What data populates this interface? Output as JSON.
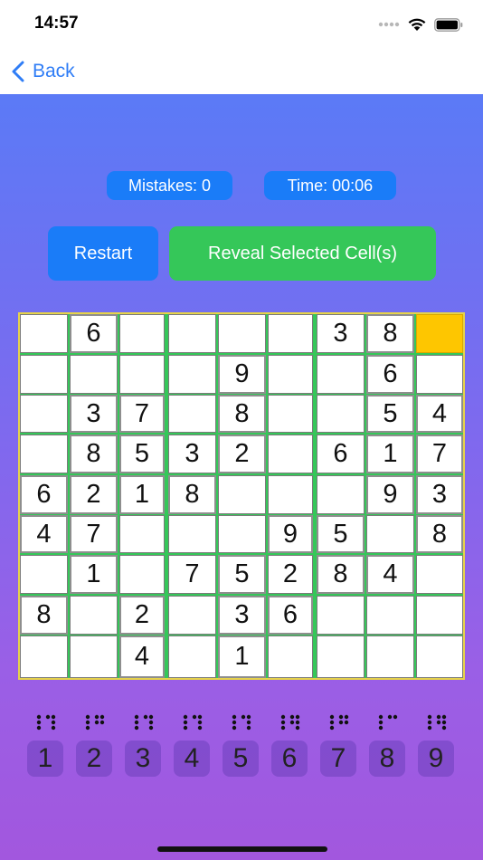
{
  "status_bar": {
    "time": "14:57"
  },
  "nav": {
    "back_label": "Back"
  },
  "stats": {
    "mistakes": "Mistakes: 0",
    "time": "Time: 00:06"
  },
  "actions": {
    "restart": "Restart",
    "reveal": "Reveal Selected Cell(s)"
  },
  "colors": {
    "accent_blue": "#1a7cf8",
    "accent_green": "#35c759",
    "selected_cell": "#fec600",
    "background_top": "#5b7af6",
    "background_bottom": "#a257de"
  },
  "board": {
    "selected": [
      0,
      8
    ],
    "rows": [
      [
        "",
        "6",
        "",
        "",
        "",
        "",
        "3",
        "8",
        ""
      ],
      [
        "",
        "",
        "",
        "",
        "9",
        "",
        "",
        "6",
        ""
      ],
      [
        "",
        "3",
        "7",
        "",
        "8",
        "",
        "",
        "5",
        "4"
      ],
      [
        "",
        "8",
        "5",
        "3",
        "2",
        "",
        "6",
        "1",
        "7"
      ],
      [
        "6",
        "2",
        "1",
        "8",
        "",
        "",
        "",
        "9",
        "3"
      ],
      [
        "4",
        "7",
        "",
        "",
        "",
        "9",
        "5",
        "",
        "8"
      ],
      [
        "",
        "1",
        "",
        "7",
        "5",
        "2",
        "8",
        "4",
        ""
      ],
      [
        "8",
        "",
        "2",
        "",
        "3",
        "6",
        "",
        "",
        ""
      ],
      [
        "",
        "",
        "4",
        "",
        "1",
        "",
        "",
        "",
        ""
      ]
    ],
    "given": [
      [
        0,
        1
      ],
      [
        0,
        7
      ],
      [
        1,
        4
      ],
      [
        1,
        7
      ],
      [
        2,
        1
      ],
      [
        2,
        2
      ],
      [
        2,
        4
      ],
      [
        2,
        7
      ],
      [
        2,
        8
      ],
      [
        3,
        1
      ],
      [
        3,
        2
      ],
      [
        3,
        4
      ],
      [
        3,
        7
      ],
      [
        3,
        8
      ],
      [
        4,
        0
      ],
      [
        4,
        1
      ],
      [
        4,
        2
      ],
      [
        4,
        3
      ],
      [
        4,
        7
      ],
      [
        4,
        8
      ],
      [
        5,
        0
      ],
      [
        5,
        1
      ],
      [
        5,
        5
      ],
      [
        5,
        6
      ],
      [
        5,
        8
      ],
      [
        6,
        1
      ],
      [
        6,
        4
      ],
      [
        6,
        6
      ],
      [
        6,
        7
      ],
      [
        7,
        0
      ],
      [
        7,
        2
      ],
      [
        7,
        4
      ],
      [
        7,
        5
      ],
      [
        8,
        2
      ],
      [
        8,
        4
      ]
    ]
  },
  "numpad": {
    "digits": [
      "1",
      "2",
      "3",
      "4",
      "5",
      "6",
      "7",
      "8",
      "9"
    ],
    "braille_cells": [
      [
        "1",
        "4",
        "5",
        "6"
      ],
      [
        "1",
        "2",
        "4",
        "5"
      ],
      [
        "1",
        "4",
        "5",
        "6"
      ],
      [
        "1",
        "4",
        "5",
        "6"
      ],
      [
        "1",
        "4",
        "5",
        "6"
      ],
      [
        "1",
        "2",
        "4",
        "5",
        "6"
      ],
      [
        "1",
        "2",
        "4",
        "5"
      ],
      [
        "1",
        "4"
      ],
      [
        "1",
        "2",
        "4",
        "5",
        "6",
        "3"
      ]
    ]
  }
}
